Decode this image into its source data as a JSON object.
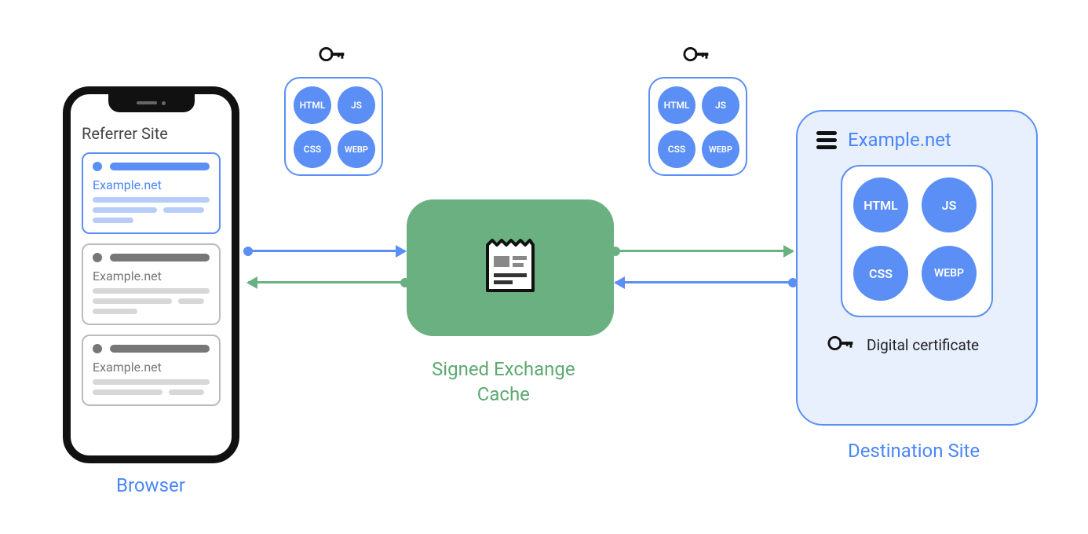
{
  "browser": {
    "label": "Browser",
    "referrer_title": "Referrer Site",
    "cards": [
      {
        "domain": "Example.net",
        "style": "blue"
      },
      {
        "domain": "Example.net",
        "style": "gray"
      },
      {
        "domain": "Example.net",
        "style": "gray"
      }
    ]
  },
  "cache": {
    "label": "Signed Exchange\nCache"
  },
  "destination": {
    "label": "Destination Site",
    "title": "Example.net",
    "certificate_label": "Digital certificate"
  },
  "resources": {
    "types": [
      "HTML",
      "JS",
      "CSS",
      "WEBP"
    ]
  }
}
